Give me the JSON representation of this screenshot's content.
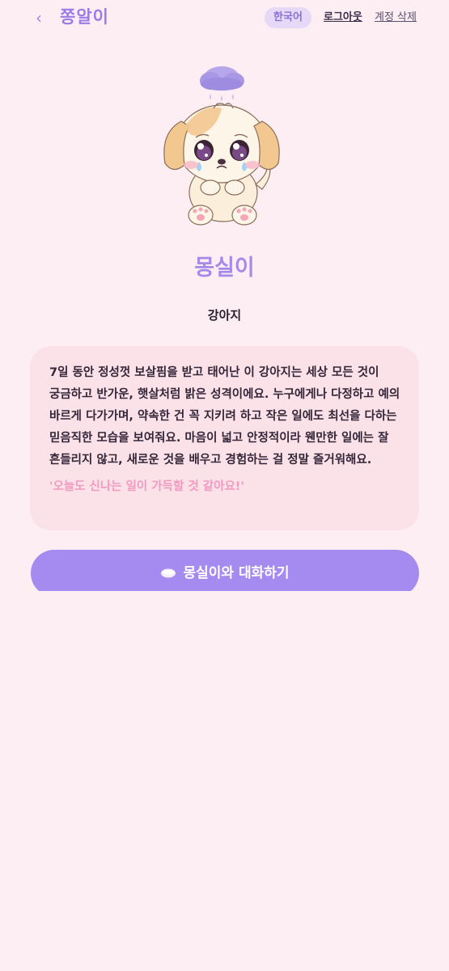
{
  "header": {
    "back_label": "‹",
    "app_title": "쫑알이",
    "lang_label": "한국어",
    "logout_label": "로그아웃",
    "delete_label": "계정 삭제"
  },
  "pet": {
    "image_icon": "sad-puppy-with-raincloud-illustration",
    "name": "몽실이",
    "species": "강아지",
    "description": "7일 동안 정성껏 보살핌을 받고 태어난 이 강아지는 세상 모든 것이 궁금하고 반가운, 햇살처럼 밝은 성격이에요. 누구에게나 다정하고 예의 바르게 다가가며, 약속한 건 꼭 지키려 하고 작은 일에도 최선을 다하는 믿음직한 모습을 보여줘요. 마음이 넓고 안정적이라 웬만한 일에는 잘 흔들리지 않고, 새로운 것을 배우고 경험하는 걸 정말 즐거워해요.",
    "quote": "'오늘도 신나는 일이 가득할 것 같아요!'"
  },
  "actions": {
    "chat_icon": "speech-bubble-icon",
    "chat_label": "몽실이와 대화하기"
  },
  "colors": {
    "background": "#fdeef4",
    "accent": "#a58af0",
    "card": "#fbe1e8",
    "quote": "#f29ac0"
  }
}
